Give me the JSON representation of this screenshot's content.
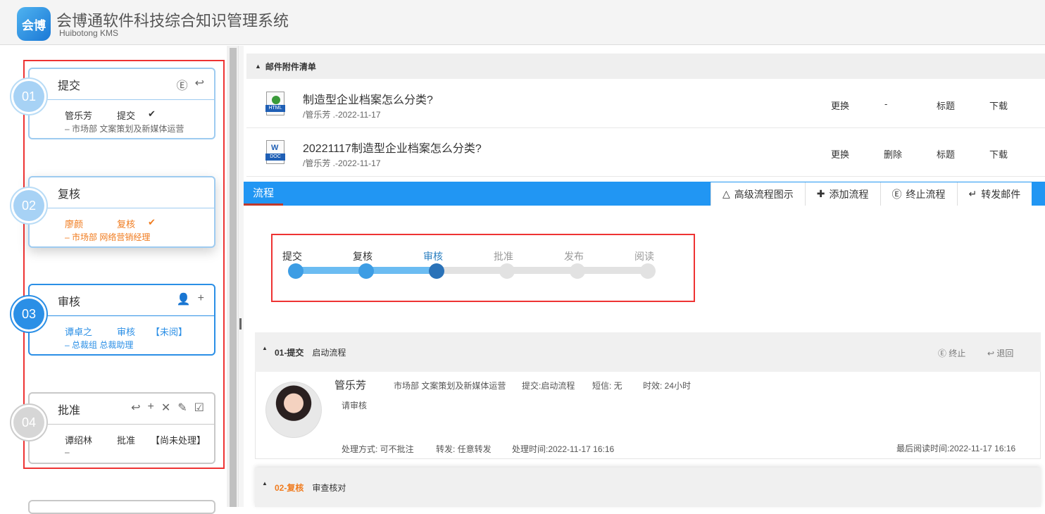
{
  "app": {
    "logo_text": "会博",
    "title": "会博通软件科技综合知识管理系统",
    "subtitle": "Huibotong KMS"
  },
  "steps": [
    {
      "num": "01",
      "name": "提交",
      "person": "管乐芳",
      "action": "提交",
      "status": "✔",
      "dept": "– 市场部 文案策划及新媒体运营",
      "icons": [
        "Ⓔ",
        "↩"
      ]
    },
    {
      "num": "02",
      "name": "复核",
      "person": "廖颜",
      "action": "复核",
      "status": "✔",
      "dept": "– 市场部 网络营销经理",
      "icons": []
    },
    {
      "num": "03",
      "name": "审核",
      "person": "谭卓之",
      "action": "审核",
      "status": "【未阅】",
      "dept": "– 总裁组 总裁助理",
      "icons": [
        "👤",
        "+"
      ]
    },
    {
      "num": "04",
      "name": "批准",
      "person": "谭绍林",
      "action": "批准",
      "status": "【尚未处理】",
      "dept": "–",
      "icons": [
        "↩",
        "+",
        "✕",
        "✎",
        "☑"
      ]
    }
  ],
  "attachments": {
    "header": "邮件附件清单",
    "files": [
      {
        "type": "HTML",
        "title": "制造型企业档案怎么分类?",
        "meta": "/管乐芳 .-2022-11-17",
        "actions": [
          "更换",
          "-",
          "标题",
          "下载"
        ]
      },
      {
        "type": "DOC",
        "title": "20221117制造型企业档案怎么分类?",
        "meta": "/管乐芳 .-2022-11-17",
        "actions": [
          "更换",
          "删除",
          "标题",
          "下载"
        ]
      }
    ]
  },
  "flow": {
    "tab": "流程",
    "buttons": [
      {
        "icon": "△",
        "label": "高级流程图示"
      },
      {
        "icon": "✚",
        "label": "添加流程"
      },
      {
        "icon": "Ⓔ",
        "label": "终止流程"
      },
      {
        "icon": "↵",
        "label": "转发邮件"
      }
    ],
    "progress": [
      "提交",
      "复核",
      "审核",
      "批准",
      "发布",
      "阅读"
    ],
    "current_step": 3
  },
  "section1": {
    "title": "01-提交",
    "subtitle": "启动流程",
    "stop": "终止",
    "back": "退回",
    "name": "管乐芳",
    "dept": "市场部 文案策划及新媒体运营",
    "submit": "提交:启动流程",
    "sms": "短信: 无",
    "timeliness": "时效: 24小时",
    "comment": "请审核",
    "method": "处理方式: 可不批注",
    "forward": "转发: 任意转发",
    "handled": "处理时间:2022-11-17 16:16",
    "last_read": "最后阅读时间:2022-11-17 16:16"
  },
  "section2": {
    "title": "02-复核",
    "subtitle": "审查核对"
  },
  "colors": {
    "accent": "#2196f3",
    "orange": "#f07b1e",
    "highlight": "#e33"
  }
}
